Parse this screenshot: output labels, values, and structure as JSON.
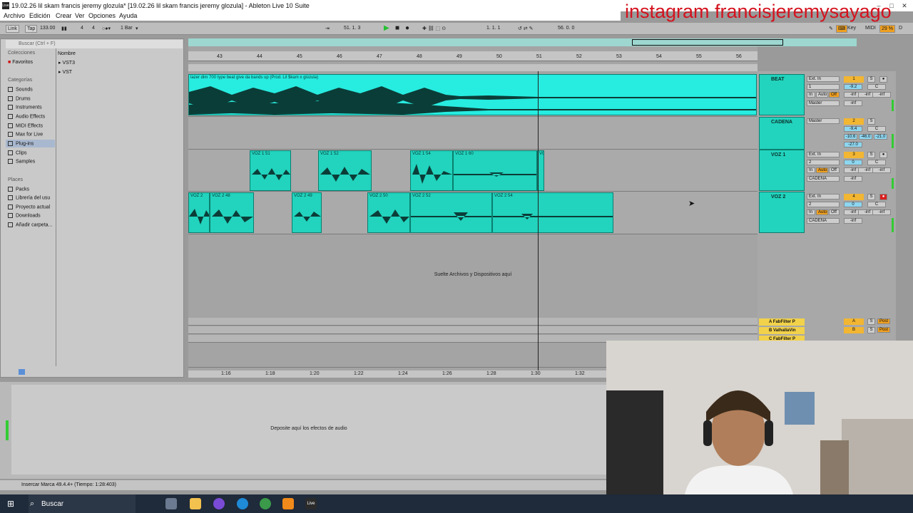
{
  "window": {
    "title": "19.02.26 lil skam francis jeremy glozula*  [19.02.26 lil skam francis jeremy glozula] - Ableton Live 10 Suite",
    "app_icon": "Live"
  },
  "watermark": "instagram francisjeremysayago",
  "menu": [
    "Archivo",
    "Edición",
    "Crear",
    "Ver",
    "Opciones",
    "Ayuda"
  ],
  "control_bar": {
    "link": "Link",
    "tap": "Tap",
    "tempo": "133.00",
    "time_sig_num": "4",
    "time_sig_den": "4",
    "quantize": "1 Bar",
    "arrangement_position": "51.  1.  3",
    "loop_start": "1.  1.  1",
    "loop_length": "56.  0.  0",
    "key": "Key",
    "midi": "MIDI",
    "cpu": "29 %",
    "colors": {
      "play_green": "#22c030",
      "cpu_orange": "#f0a020"
    }
  },
  "browser": {
    "search_placeholder": "Buscar (Ctrl + F)",
    "collections_header": "Colecciones",
    "favorites": "Favoritos",
    "categories_header": "Categorías",
    "categories": [
      "Sounds",
      "Drums",
      "Instruments",
      "Audio Effects",
      "MIDI Effects",
      "Max for Live",
      "Plug-ins",
      "Clips",
      "Samples"
    ],
    "selected_category": "Plug-ins",
    "places_header": "Places",
    "places": [
      "Packs",
      "Librería del usu",
      "Proyecto actual",
      "Downloads",
      "Añadir carpeta..."
    ],
    "column_header": "Nombre",
    "items": [
      "VST3",
      "VST"
    ]
  },
  "ruler": {
    "bars": [
      "43",
      "44",
      "45",
      "46",
      "47",
      "48",
      "49",
      "50",
      "51",
      "52",
      "53",
      "54",
      "55",
      "56"
    ]
  },
  "bottom_ruler": {
    "times": [
      "1:16",
      "1:18",
      "1:20",
      "1:22",
      "1:24",
      "1:26",
      "1:28",
      "1:30",
      "1:32"
    ]
  },
  "clips": {
    "beat": "lazer dim 700  type beat give da bands up (Prod. Lil $kam x glozula)",
    "voz1": [
      "VOZ 1 51",
      "VOZ 1 52",
      "VOZ 1 54",
      "VOZ 1 60",
      "VO"
    ],
    "voz2": [
      "VOZ 2",
      "VOZ 2 48",
      "VOZ 2 49",
      "VOZ 2 50",
      "VOZ 2 52",
      "VOZ 2 54"
    ]
  },
  "drop_text": "Suelte Archivos y Dispositivos aquí",
  "tracks": [
    {
      "name": "BEAT",
      "input": "Ext. In",
      "channel": "1",
      "output": "Master",
      "number": "1",
      "volume": "-9.2",
      "pan": "C",
      "color": "#22d3bd"
    },
    {
      "name": "CADENA",
      "input": "",
      "channel": "",
      "output": "Master",
      "number": "2",
      "volume": "-9.4",
      "pan": "C",
      "extra": [
        "-10.6",
        "-46.0",
        "-21.0",
        "-27.0"
      ],
      "color": "#22d3bd"
    },
    {
      "name": "VOZ 1",
      "input": "Ext. In",
      "channel": "2",
      "output": "CADENA",
      "number": "3",
      "volume": "0",
      "pan": "C",
      "color": "#22d3bd"
    },
    {
      "name": "VOZ 2",
      "input": "Ext. In",
      "channel": "2",
      "output": "CADENA",
      "number": "4",
      "volume": "0",
      "pan": "C",
      "color": "#22d3bd"
    }
  ],
  "mixer_labels": {
    "in": "In",
    "auto": "Auto",
    "off": "Off",
    "inf": "-inf",
    "solo": "S",
    "post": "Post"
  },
  "returns": [
    {
      "name": "A FabFilter P",
      "letter": "A"
    },
    {
      "name": "B ValhallaVin",
      "letter": "B"
    },
    {
      "name": "C FabFilter P",
      "letter": "C"
    }
  ],
  "detail_text": "Deposite aquí los efectos de audio",
  "status": "Insercar Marca 49.4.4+ (Tiempo: 1:28:403)",
  "taskbar": {
    "search": "Buscar",
    "live_label": "Live"
  }
}
